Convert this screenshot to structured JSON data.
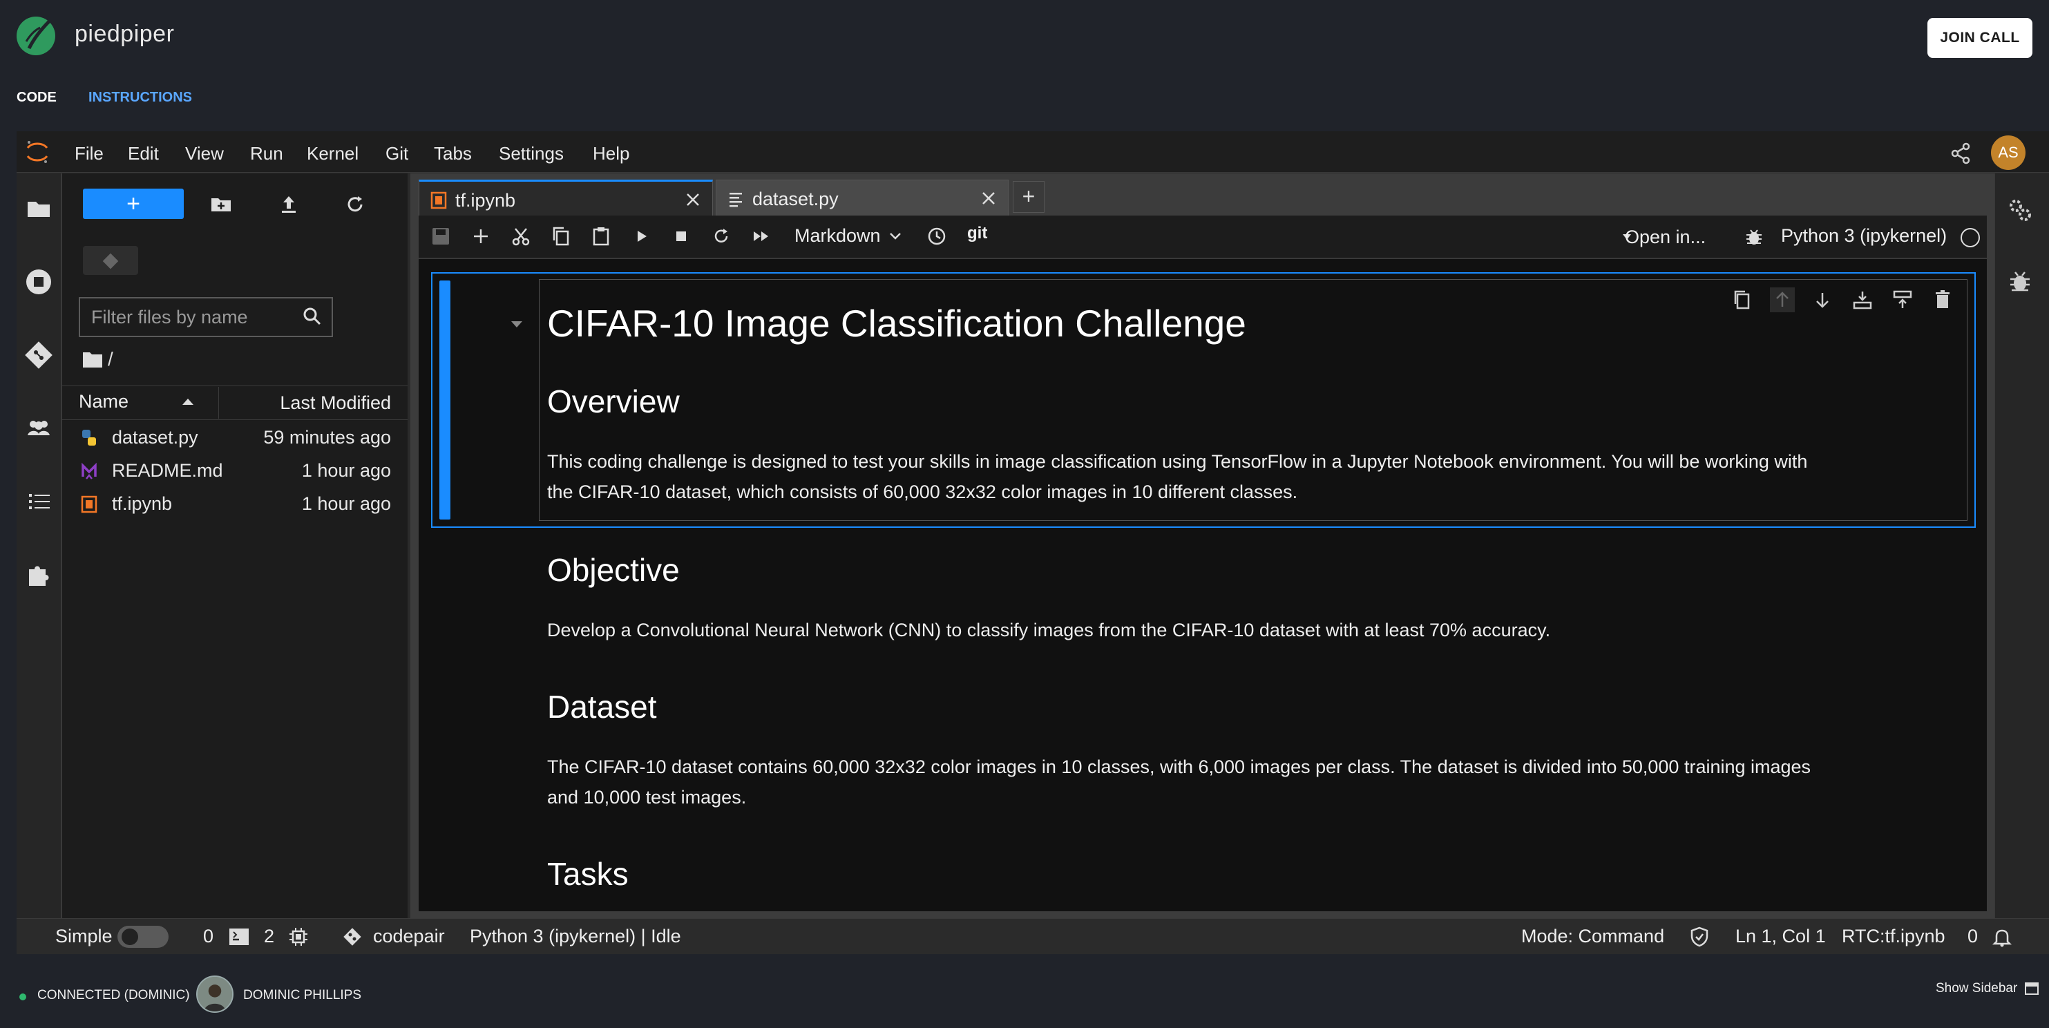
{
  "app": {
    "brand": "piedpiper",
    "join_call": "JOIN CALL"
  },
  "top_tabs": {
    "code": "CODE",
    "instructions": "INSTRUCTIONS"
  },
  "menubar": {
    "items": [
      "File",
      "Edit",
      "View",
      "Run",
      "Kernel",
      "Git",
      "Tabs",
      "Settings",
      "Help"
    ],
    "user_initials": "AS"
  },
  "file_browser": {
    "new_button": "+",
    "filter_placeholder": "Filter files by name",
    "breadcrumb": "/",
    "col_name": "Name",
    "col_modified": "Last Modified",
    "files": [
      {
        "name": "dataset.py",
        "modified": "59 minutes ago",
        "icon": "python-file-icon"
      },
      {
        "name": "README.md",
        "modified": "1 hour ago",
        "icon": "markdown-file-icon"
      },
      {
        "name": "tf.ipynb",
        "modified": "1 hour ago",
        "icon": "notebook-file-icon"
      }
    ]
  },
  "doc_tabs": {
    "tf": "tf.ipynb",
    "dataset": "dataset.py",
    "add": "+"
  },
  "notebook_toolbar": {
    "cell_type": "Markdown",
    "git": "git",
    "open_in": "Open in...",
    "kernel": "Python 3 (ipykernel)"
  },
  "notebook": {
    "title": "CIFAR-10 Image Classification Challenge",
    "overview_heading": "Overview",
    "overview_p1": "This coding challenge is designed to test your skills in image classification using TensorFlow in a Jupyter Notebook environment. You will be working with",
    "overview_p2": "the CIFAR-10 dataset, which consists of 60,000 32x32 color images in 10 different classes.",
    "objective_heading": "Objective",
    "objective_p": "Develop a Convolutional Neural Network (CNN) to classify images from the CIFAR-10 dataset with at least 70% accuracy.",
    "dataset_heading": "Dataset",
    "dataset_p1": "The CIFAR-10 dataset contains 60,000 32x32 color images in 10 classes, with 6,000 images per class. The dataset is divided into 50,000 training images",
    "dataset_p2": "and 10,000 test images.",
    "tasks_heading": "Tasks"
  },
  "statusbar": {
    "simple": "Simple",
    "terminals": "0",
    "kernels": "2",
    "git_label": "codepair",
    "kernel_status": "Python 3 (ipykernel) | Idle",
    "mode": "Mode: Command",
    "position": "Ln 1, Col 1",
    "rtc": "RTC:tf.ipynb",
    "notifications": "0"
  },
  "callbar": {
    "connection": "CONNECTED (DOMINIC)",
    "participant": "DOMINIC PHILLIPS",
    "show_sidebar": "Show Sidebar"
  },
  "colors": {
    "accent": "#1a8cff",
    "link": "#5aa7ff",
    "connected": "#2fb86e",
    "avatar": "#c3832a"
  }
}
